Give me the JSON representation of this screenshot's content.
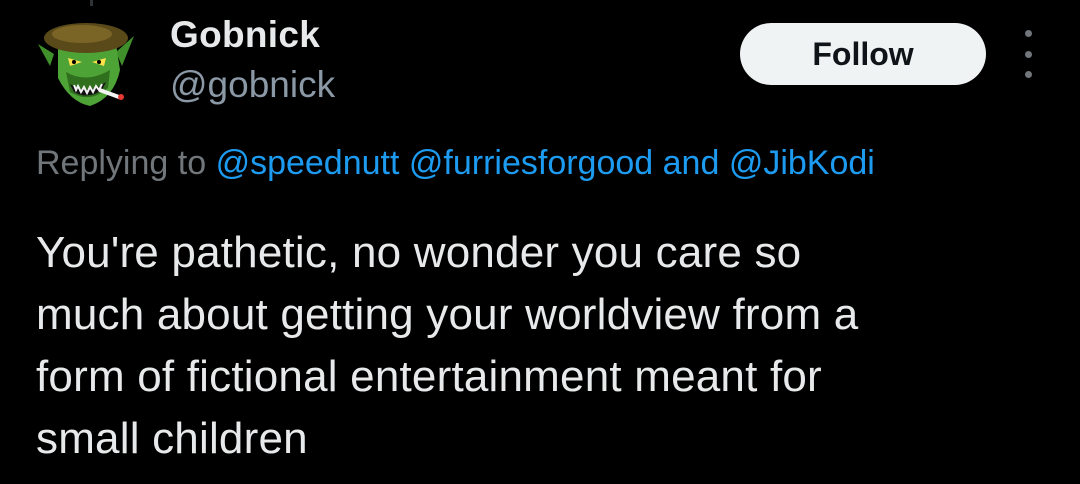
{
  "author": {
    "display_name": "Gobnick",
    "handle": "@gobnick",
    "avatar_icon": "goblin-avatar-icon"
  },
  "actions": {
    "follow_label": "Follow",
    "more_icon": "more-vertical-icon"
  },
  "reply": {
    "prefix": "Replying to",
    "mentions": [
      "@speednutt",
      "@furriesforgood",
      "@JibKodi"
    ],
    "joiner": "and"
  },
  "tweet": {
    "lines": [
      "You're pathetic, no wonder you care so",
      "much about getting your worldview from a",
      "form of fictional entertainment meant for",
      "small children"
    ]
  },
  "colors": {
    "background": "#000000",
    "text_primary": "#e7e9ea",
    "text_secondary": "#71767b",
    "link": "#1d9bf0",
    "follow_bg": "#eff3f4",
    "follow_text": "#0f1419"
  }
}
